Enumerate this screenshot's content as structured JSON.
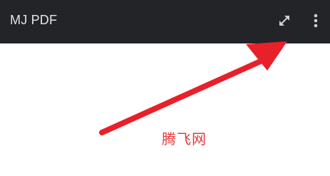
{
  "toolbar": {
    "title": "MJ PDF",
    "background_color": "#222428",
    "actions": [
      {
        "icon": "expand-icon"
      },
      {
        "icon": "more-vertical-icon"
      }
    ]
  },
  "annotation": {
    "arrow_color": "#e8202a",
    "watermark_text": "腾飞网",
    "watermark_color": "#e23a3a"
  }
}
